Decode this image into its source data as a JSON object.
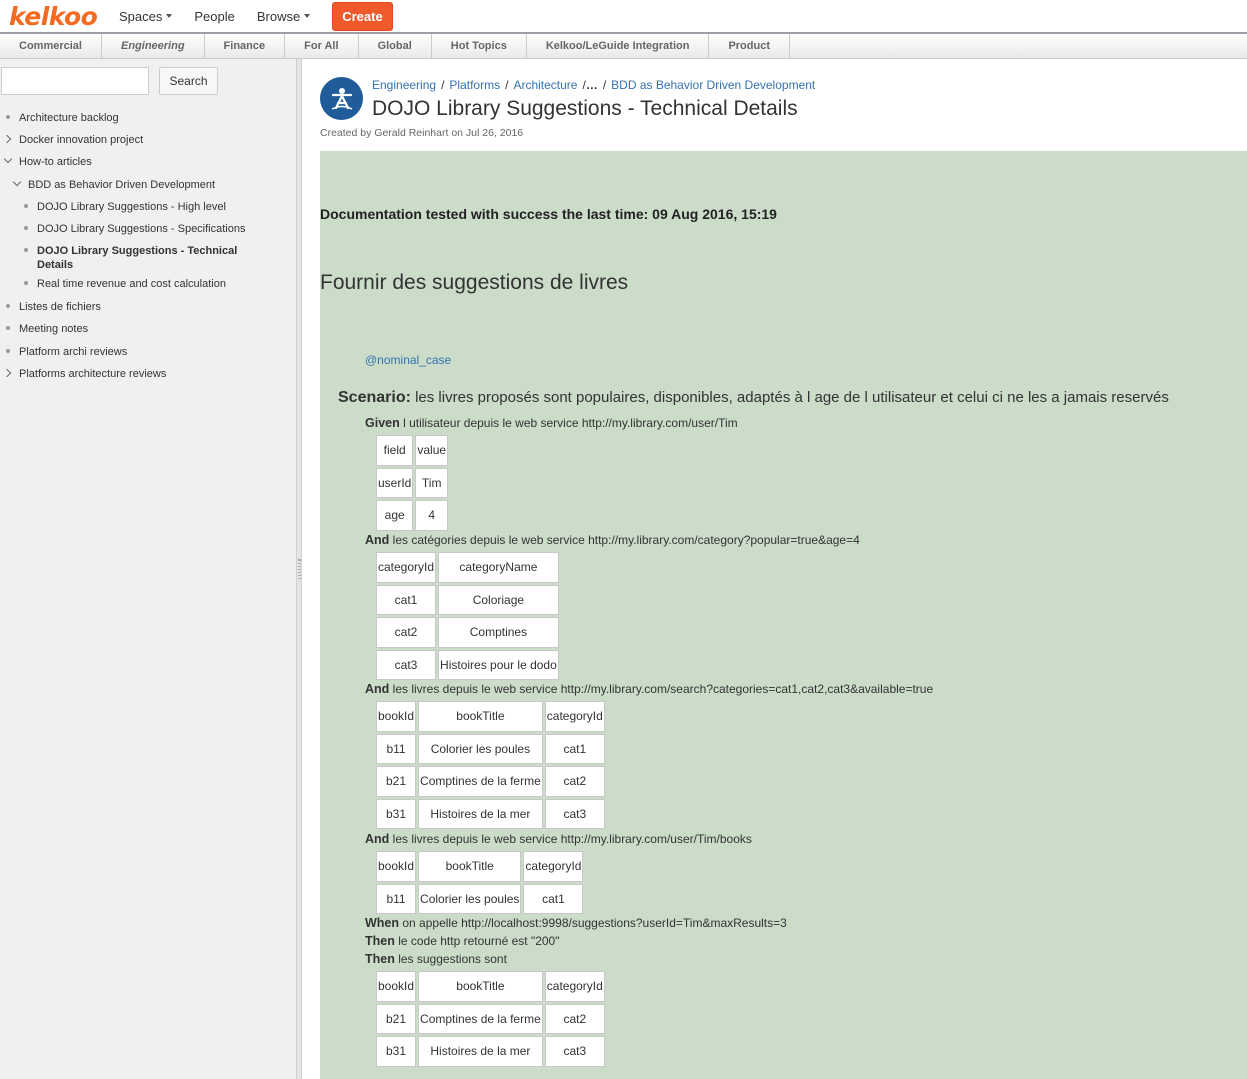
{
  "header": {
    "logo": "kelkoo",
    "nav": [
      {
        "label": "Spaces",
        "dropdown": true
      },
      {
        "label": "People",
        "dropdown": false
      },
      {
        "label": "Browse",
        "dropdown": true
      }
    ],
    "create_label": "Create"
  },
  "space_tabs": [
    {
      "label": "Commercial"
    },
    {
      "label": "Engineering",
      "active": true
    },
    {
      "label": "Finance"
    },
    {
      "label": "For All"
    },
    {
      "label": "Global"
    },
    {
      "label": "Hot Topics"
    },
    {
      "label": "Kelkoo/LeGuide Integration"
    },
    {
      "label": "Product"
    }
  ],
  "sidebar": {
    "search_value": "",
    "search_button": "Search",
    "tree": [
      {
        "label": "Architecture backlog",
        "type": "bullet",
        "level": 0
      },
      {
        "label": "Docker innovation project",
        "type": "collapsed",
        "level": 0
      },
      {
        "label": "How-to articles",
        "type": "expanded",
        "level": 0
      },
      {
        "label": "BDD as Behavior Driven Development",
        "type": "expanded",
        "level": 1
      },
      {
        "label": "DOJO Library Suggestions - High level",
        "type": "bullet",
        "level": 2
      },
      {
        "label": "DOJO Library Suggestions - Specifications",
        "type": "bullet",
        "level": 2
      },
      {
        "label": "DOJO Library Suggestions - Technical Details",
        "type": "bullet",
        "level": 2,
        "current": true
      },
      {
        "label": "Real time revenue and cost calculation",
        "type": "bullet",
        "level": 2
      },
      {
        "label": "Listes de fichiers",
        "type": "bullet",
        "level": 0
      },
      {
        "label": "Meeting notes",
        "type": "bullet",
        "level": 0
      },
      {
        "label": "Platform archi reviews",
        "type": "bullet",
        "level": 0
      },
      {
        "label": "Platforms architecture reviews",
        "type": "collapsed",
        "level": 0
      }
    ]
  },
  "page": {
    "breadcrumbs": [
      "Engineering",
      "Platforms",
      "Architecture",
      "…",
      "BDD as Behavior Driven Development"
    ],
    "title": "DOJO Library Suggestions - Technical Details",
    "byline": "Created by Gerald Reinhart on Jul 26, 2016",
    "doc_tested": "Documentation tested with success the last time: 09 Aug 2016, 15:19",
    "heading": "Fournir des suggestions de livres",
    "tag": "@nominal_case",
    "scenario_keyword": "Scenario:",
    "scenario_text": "les livres proposés sont populaires, disponibles, adaptés à l age de l utilisateur et celui ci ne les a jamais reservés",
    "steps": [
      {
        "kw": "Given",
        "text": "l utilisateur depuis le web service http://my.library.com/user/Tim"
      },
      {
        "kw": "And",
        "text": "les catégories depuis le web service http://my.library.com/category?popular=true&age=4"
      },
      {
        "kw": "And",
        "text": "les livres depuis le web service http://my.library.com/search?categories=cat1,cat2,cat3&available=true"
      },
      {
        "kw": "And",
        "text": "les livres depuis le web service http://my.library.com/user/Tim/books"
      },
      {
        "kw": "When",
        "text": "on appelle http://localhost:9998/suggestions?userId=Tim&maxResults=3"
      },
      {
        "kw": "Then",
        "text": "le code http retourné est \"200\""
      },
      {
        "kw": "Then",
        "text": "les suggestions sont"
      }
    ],
    "tables": [
      [
        [
          "field",
          "value"
        ],
        [
          "userId",
          "Tim"
        ],
        [
          "age",
          "4"
        ]
      ],
      [
        [
          "categoryId",
          "categoryName"
        ],
        [
          "cat1",
          "Coloriage"
        ],
        [
          "cat2",
          "Comptines"
        ],
        [
          "cat3",
          "Histoires pour le dodo"
        ]
      ],
      [
        [
          "bookId",
          "bookTitle",
          "categoryId"
        ],
        [
          "b11",
          "Colorier les poules",
          "cat1"
        ],
        [
          "b21",
          "Comptines de la ferme",
          "cat2"
        ],
        [
          "b31",
          "Histoires de la mer",
          "cat3"
        ]
      ],
      [
        [
          "bookId",
          "bookTitle",
          "categoryId"
        ],
        [
          "b11",
          "Colorier les poules",
          "cat1"
        ]
      ],
      [
        [
          "bookId",
          "bookTitle",
          "categoryId"
        ],
        [
          "b21",
          "Comptines de la ferme",
          "cat2"
        ],
        [
          "b31",
          "Histoires de la mer",
          "cat3"
        ]
      ]
    ]
  },
  "colors": {
    "brand": "#f36b21",
    "create_button": "#f0592a",
    "link": "#3572b0",
    "content_bg": "#cbdcc9",
    "space_logo": "#1f5c99"
  }
}
